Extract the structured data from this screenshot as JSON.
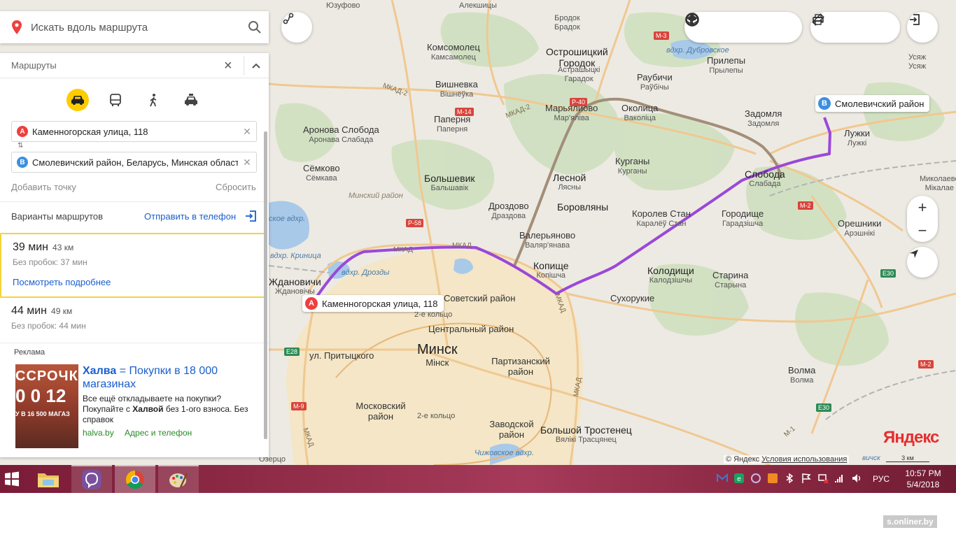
{
  "search": {
    "placeholder": "Искать вдоль маршрута"
  },
  "panel": {
    "title": "Маршруты",
    "modes": [
      "car",
      "public-transport",
      "walk",
      "taxi"
    ],
    "from": "Каменногорская улица, 118",
    "to": "Смолевичский район, Беларусь, Минская область",
    "from_pin": "A",
    "to_pin": "B",
    "add_point": "Добавить точку",
    "reset": "Сбросить",
    "variants_title": "Варианты маршрутов",
    "send_to_phone": "Отправить в телефон",
    "variants": [
      {
        "time": "39 мин",
        "distance": "43 км",
        "no_traffic": "Без пробок: 37 мин",
        "details": "Посмотреть подробнее"
      },
      {
        "time": "44 мин",
        "distance": "49 км",
        "no_traffic": "Без пробок: 44 мин"
      }
    ],
    "ad": {
      "label": "Реклама",
      "title_brand": "Халва",
      "title_rest": " = Покупки в 18 000 магазинах",
      "body1": "Все ещё откладываете на покупки? Покупайте с ",
      "body_brand": "Халвой",
      "body2": " без 1-ого взноса. Без справок",
      "domain": "halva.by",
      "contacts": "Адрес и телефон",
      "img_line1": "ССРОЧК",
      "img_line2": "0  0  12",
      "img_line3": "У В 16 500 МАГАЗ"
    }
  },
  "map": {
    "markers": {
      "a_label": "Каменногорская улица, 118",
      "b_label": "Смолевичский район"
    },
    "places": [
      {
        "id": "minsk",
        "l1": "Минск",
        "l2": "Мінск"
      },
      {
        "id": "ostroshitsky",
        "l1": "Острошицкий",
        "l2": "Городок"
      },
      {
        "id": "ostroshitsky-by",
        "l1": "Астрашыцкі",
        "l2": "Гарадок"
      },
      {
        "id": "bolshevik",
        "l1": "Большевик",
        "l2": "Бальшавік"
      },
      {
        "id": "lesnoy",
        "l1": "Лесной",
        "l2": "Лясны"
      },
      {
        "id": "borovlyany",
        "l1": "Боровляны",
        "l2": ""
      },
      {
        "id": "kopishche",
        "l1": "Копище",
        "l2": "Копішча"
      },
      {
        "id": "kolodishchi",
        "l1": "Колодищи",
        "l2": "Калодзішчы"
      },
      {
        "id": "sloboda",
        "l1": "Слобода",
        "l2": "Слабада"
      },
      {
        "id": "bolshoy-trostenets",
        "l1": "Большой Тростенец",
        "l2": "Вялікі Трасцянец"
      },
      {
        "id": "zhdanovichi",
        "l1": "Ждановичи",
        "l2": "Ждановічы"
      },
      {
        "id": "komsomolets",
        "l1": "Комсомолец",
        "l2": "Камсамолец"
      },
      {
        "id": "vishnevka",
        "l1": "Вишневка",
        "l2": "Вішнёўка"
      },
      {
        "id": "paperna",
        "l1": "Паперня",
        "l2": "Паперня"
      },
      {
        "id": "aronova",
        "l1": "Аронова Слобода",
        "l2": "Аронава Слабада"
      },
      {
        "id": "semkovo",
        "l1": "Сёмково",
        "l2": "Сёмкава"
      },
      {
        "id": "drozdovo",
        "l1": "Дроздово",
        "l2": "Драздова"
      },
      {
        "id": "valeryanovo",
        "l1": "Валерьяново",
        "l2": "Валяр'янава"
      },
      {
        "id": "korolev-stan",
        "l1": "Королев Стан",
        "l2": "Каралёў Стан"
      },
      {
        "id": "gorodishche",
        "l1": "Городище",
        "l2": "Гарадзішча"
      },
      {
        "id": "kurgany",
        "l1": "Курганы",
        "l2": "Курганы"
      },
      {
        "id": "okolitsa",
        "l1": "Околица",
        "l2": "Ваколіца"
      },
      {
        "id": "maryalivo",
        "l1": "Марьялиово",
        "l2": "Мар'яліва"
      },
      {
        "id": "raubichi",
        "l1": "Раубичи",
        "l2": "Раўбічы"
      },
      {
        "id": "prilepy",
        "l1": "Прилепы",
        "l2": "Прылепы"
      },
      {
        "id": "zadomlya",
        "l1": "Задомля",
        "l2": "Задомля"
      },
      {
        "id": "luzhki",
        "l1": "Лужки",
        "l2": "Лужкі"
      },
      {
        "id": "oreshniki",
        "l1": "Орешники",
        "l2": "Арэшнікі"
      },
      {
        "id": "starina",
        "l1": "Старина",
        "l2": "Старына"
      },
      {
        "id": "sukhorukie",
        "l1": "Сухорукие",
        "l2": ""
      },
      {
        "id": "volma",
        "l1": "Волма",
        "l2": "Волма"
      },
      {
        "id": "yuzufova",
        "l1": "Юзуфово",
        "l2": ""
      },
      {
        "id": "alekshitsy",
        "l1": "Алекшицы",
        "l2": ""
      },
      {
        "id": "brodok",
        "l1": "Бродок",
        "l2": "Брадок"
      },
      {
        "id": "usyazh",
        "l1": "Усяж",
        "l2": "Усяж"
      },
      {
        "id": "mikolaevo",
        "l1": "Миколаево",
        "l2": "Мікалае"
      }
    ],
    "districts": {
      "sovetsky": "Советский район",
      "central": "Центральный район",
      "partizansky": "Партизанский район",
      "zavodskoy": "Заводской район",
      "moskovsky": "Московский район",
      "minsky": "Минский район"
    },
    "streets": {
      "pritytskogo": "ул. Притыцкого",
      "ring2a": "2-е кольцо",
      "ring2b": "2-е кольцо",
      "mkad1": "МКАД",
      "mkad2": "МКАД",
      "mkad3": "МКАД",
      "mkad4": "МКАД",
      "mkad2a": "МКАД-2",
      "mkad2b": "МКАД-2",
      "kaad": "МКАД"
    },
    "waters": {
      "drozdy": "вдхр. Дрозды",
      "krinitsa": "вдхр. Криница",
      "dubrovskoe": "вдхр. Дубровское",
      "chizhovskoe": "Чижовское вдхр.",
      "zaslavskoe": "ское вдхр.",
      "ozertso": "Озерцо"
    },
    "road_tags": [
      "М-3",
      "М-14",
      "Р-40",
      "Р-58",
      "Е28",
      "М-9",
      "М-2",
      "Е30",
      "Е30",
      "М-1",
      "М-2"
    ],
    "copyright": "© Яндекс",
    "terms": "Условия использования",
    "scale": "3 км",
    "logo": "Яндекс",
    "partial_edge_label": "вичск"
  },
  "taskbar": {
    "lang": "РУС",
    "time": "10:57 PM",
    "date": "5/4/2018"
  },
  "watermark": "s.onliner.by",
  "colors": {
    "route_main": "#9b48d8",
    "route_alt": "#a28f78",
    "marker_a": "#ee3f3f",
    "marker_b": "#3d8fe0",
    "mode_active": "#ffcc00",
    "link": "#1a5fcc"
  }
}
